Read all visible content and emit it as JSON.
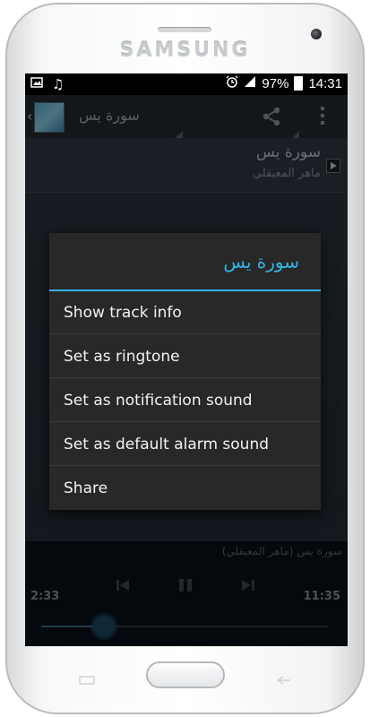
{
  "device": {
    "brand": "SAMSUNG"
  },
  "status_bar": {
    "battery": "97%",
    "time": "14:31"
  },
  "action_bar": {
    "title": "سورة يس"
  },
  "track": {
    "title": "سورة يس",
    "artist": "ماهر المعيقلي"
  },
  "dialog": {
    "title": "سورة يس",
    "items": [
      "Show track info",
      "Set as ringtone",
      "Set as notification sound",
      "Set as default alarm sound",
      "Share"
    ]
  },
  "player": {
    "now_playing": "سورة يس (ماهر المعيقلي)",
    "elapsed": "2:33",
    "duration": "11:35",
    "progress": 0.22
  },
  "colors": {
    "accent": "#33b5e5",
    "dialog_bg": "#282828"
  },
  "icons": [
    "gallery-icon",
    "music-note-icon",
    "alarm-icon",
    "signal-icon",
    "battery-icon",
    "back-chevron-icon",
    "share-icon",
    "overflow-menu-icon",
    "now-playing-icon",
    "previous-icon",
    "pause-icon",
    "next-icon"
  ]
}
